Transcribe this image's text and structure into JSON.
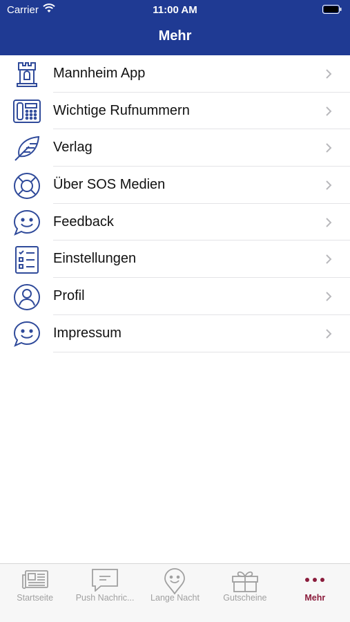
{
  "status_bar": {
    "carrier": "Carrier",
    "time": "11:00 AM"
  },
  "nav": {
    "title": "Mehr"
  },
  "menu": [
    {
      "label": "Mannheim App",
      "icon": "tower-icon"
    },
    {
      "label": "Wichtige Rufnummern",
      "icon": "phone-icon"
    },
    {
      "label": "Verlag",
      "icon": "feather-icon"
    },
    {
      "label": "Über SOS Medien",
      "icon": "lifebuoy-icon"
    },
    {
      "label": "Feedback",
      "icon": "smiley-bubble-icon"
    },
    {
      "label": "Einstellungen",
      "icon": "checklist-icon"
    },
    {
      "label": "Profil",
      "icon": "user-icon"
    },
    {
      "label": "Impressum",
      "icon": "smiley-bubble-icon"
    }
  ],
  "tabs": [
    {
      "label": "Startseite",
      "icon": "newspaper-icon",
      "active": false
    },
    {
      "label": "Push Nachric...",
      "icon": "message-icon",
      "active": false
    },
    {
      "label": "Lange Nacht",
      "icon": "smiley-pin-icon",
      "active": false
    },
    {
      "label": "Gutscheine",
      "icon": "gift-icon",
      "active": false
    },
    {
      "label": "Mehr",
      "icon": "more-icon",
      "active": true
    }
  ],
  "colors": {
    "header": "#1f3a93",
    "icon": "#2f4a9a",
    "active_tab": "#8b1c3c",
    "inactive_tab": "#a0a0a0"
  }
}
